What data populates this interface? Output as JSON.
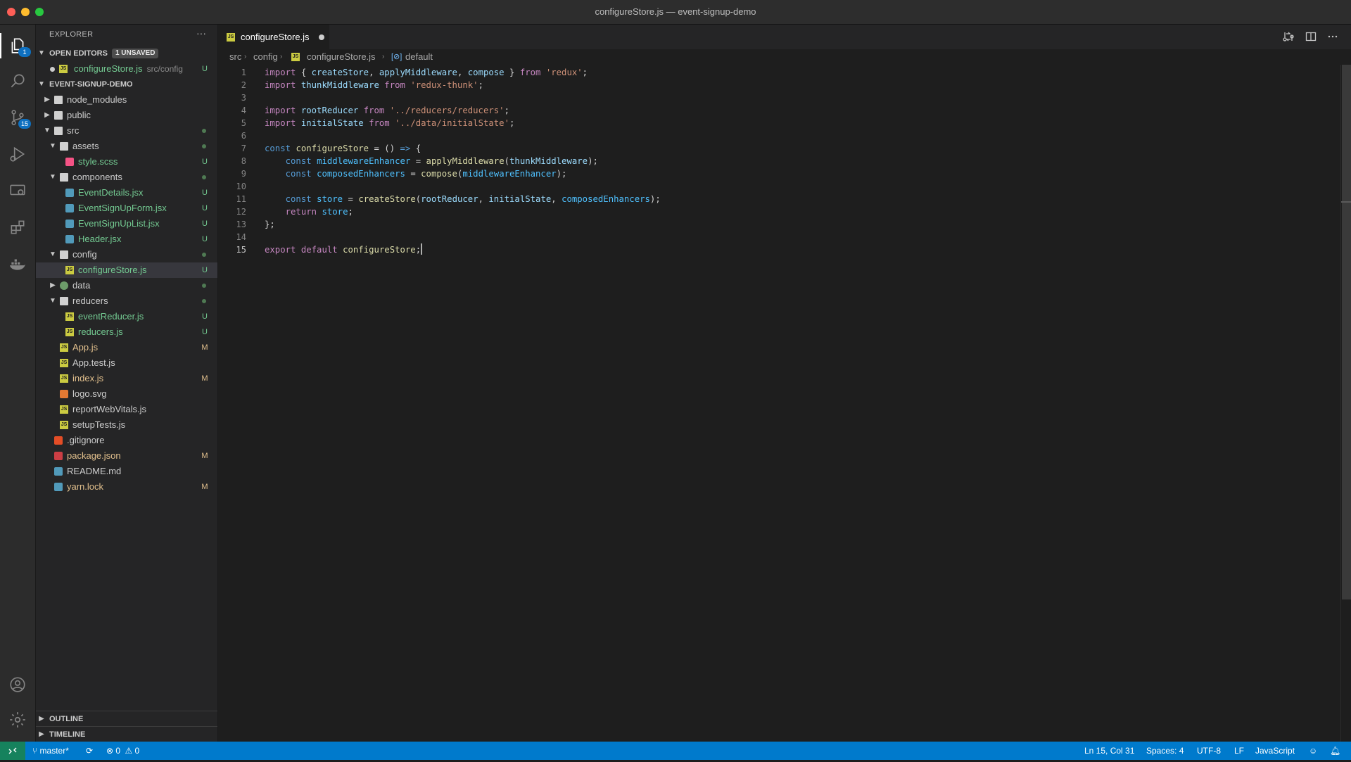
{
  "window": {
    "title": "configureStore.js — event-signup-demo"
  },
  "activity_bar": {
    "source_control_badge": "15",
    "explorer_badge": "1"
  },
  "sidebar": {
    "title": "EXPLORER",
    "more": "···",
    "open_editors": {
      "label": "OPEN EDITORS",
      "badge": "1 UNSAVED",
      "items": [
        {
          "name": "configureStore.js",
          "path": "src/config",
          "status": "U"
        }
      ]
    },
    "project": {
      "label": "EVENT-SIGNUP-DEMO",
      "tree": [
        {
          "name": "node_modules",
          "depth": 0,
          "kind": "folder",
          "open": false,
          "status": ""
        },
        {
          "name": "public",
          "depth": 0,
          "kind": "folder",
          "open": false,
          "status": ""
        },
        {
          "name": "src",
          "depth": 0,
          "kind": "folder",
          "open": true,
          "status": "dot"
        },
        {
          "name": "assets",
          "depth": 1,
          "kind": "folder",
          "open": true,
          "status": "dot"
        },
        {
          "name": "style.scss",
          "depth": 2,
          "kind": "scss",
          "status": "U"
        },
        {
          "name": "components",
          "depth": 1,
          "kind": "folder",
          "open": true,
          "status": "dot"
        },
        {
          "name": "EventDetails.jsx",
          "depth": 2,
          "kind": "jsx",
          "status": "U"
        },
        {
          "name": "EventSignUpForm.jsx",
          "depth": 2,
          "kind": "jsx",
          "status": "U"
        },
        {
          "name": "EventSignUpList.jsx",
          "depth": 2,
          "kind": "jsx",
          "status": "U"
        },
        {
          "name": "Header.jsx",
          "depth": 2,
          "kind": "jsx",
          "status": "U"
        },
        {
          "name": "config",
          "depth": 1,
          "kind": "folder",
          "open": true,
          "status": "dot"
        },
        {
          "name": "configureStore.js",
          "depth": 2,
          "kind": "js",
          "status": "U",
          "selected": true
        },
        {
          "name": "data",
          "depth": 1,
          "kind": "folder-data",
          "open": false,
          "status": "dot"
        },
        {
          "name": "reducers",
          "depth": 1,
          "kind": "folder",
          "open": true,
          "status": "dot"
        },
        {
          "name": "eventReducer.js",
          "depth": 2,
          "kind": "js",
          "status": "U"
        },
        {
          "name": "reducers.js",
          "depth": 2,
          "kind": "js",
          "status": "U"
        },
        {
          "name": "App.js",
          "depth": 1,
          "kind": "js",
          "status": "M"
        },
        {
          "name": "App.test.js",
          "depth": 1,
          "kind": "test",
          "status": ""
        },
        {
          "name": "index.js",
          "depth": 1,
          "kind": "js",
          "status": "M"
        },
        {
          "name": "logo.svg",
          "depth": 1,
          "kind": "svg",
          "status": ""
        },
        {
          "name": "reportWebVitals.js",
          "depth": 1,
          "kind": "js",
          "status": ""
        },
        {
          "name": "setupTests.js",
          "depth": 1,
          "kind": "js",
          "status": ""
        },
        {
          "name": ".gitignore",
          "depth": 0,
          "kind": "git",
          "status": ""
        },
        {
          "name": "package.json",
          "depth": 0,
          "kind": "json",
          "status": "M"
        },
        {
          "name": "README.md",
          "depth": 0,
          "kind": "md",
          "status": ""
        },
        {
          "name": "yarn.lock",
          "depth": 0,
          "kind": "yarn",
          "status": "M"
        }
      ]
    },
    "outline_label": "OUTLINE",
    "timeline_label": "TIMELINE"
  },
  "editor": {
    "tab": {
      "label": "configureStore.js",
      "dirty": true
    },
    "breadcrumb": [
      "src",
      "config",
      "configureStore.js",
      "default"
    ],
    "lines": [
      [
        [
          "kw",
          "import"
        ],
        [
          "p",
          " { "
        ],
        [
          "vr",
          "createStore"
        ],
        [
          "p",
          ", "
        ],
        [
          "vr",
          "applyMiddleware"
        ],
        [
          "p",
          ", "
        ],
        [
          "vr",
          "compose"
        ],
        [
          "p",
          " } "
        ],
        [
          "kw",
          "from"
        ],
        [
          "p",
          " "
        ],
        [
          "str",
          "'redux'"
        ],
        [
          "p",
          ";"
        ]
      ],
      [
        [
          "kw",
          "import"
        ],
        [
          "p",
          " "
        ],
        [
          "vr",
          "thunkMiddleware"
        ],
        [
          "p",
          " "
        ],
        [
          "kw",
          "from"
        ],
        [
          "p",
          " "
        ],
        [
          "str",
          "'redux-thunk'"
        ],
        [
          "p",
          ";"
        ]
      ],
      [],
      [
        [
          "kw",
          "import"
        ],
        [
          "p",
          " "
        ],
        [
          "vr",
          "rootReducer"
        ],
        [
          "p",
          " "
        ],
        [
          "kw",
          "from"
        ],
        [
          "p",
          " "
        ],
        [
          "str",
          "'../reducers/reducers'"
        ],
        [
          "p",
          ";"
        ]
      ],
      [
        [
          "kw",
          "import"
        ],
        [
          "p",
          " "
        ],
        [
          "vr",
          "initialState"
        ],
        [
          "p",
          " "
        ],
        [
          "kw",
          "from"
        ],
        [
          "p",
          " "
        ],
        [
          "str",
          "'../data/initialState'"
        ],
        [
          "p",
          ";"
        ]
      ],
      [],
      [
        [
          "kd",
          "const"
        ],
        [
          "p",
          " "
        ],
        [
          "fn",
          "configureStore"
        ],
        [
          "p",
          " = () "
        ],
        [
          "kd",
          "=>"
        ],
        [
          "p",
          " {"
        ]
      ],
      [
        [
          "p",
          "    "
        ],
        [
          "kd",
          "const"
        ],
        [
          "p",
          " "
        ],
        [
          "cn",
          "middlewareEnhancer"
        ],
        [
          "p",
          " = "
        ],
        [
          "fn",
          "applyMiddleware"
        ],
        [
          "p",
          "("
        ],
        [
          "vr",
          "thunkMiddleware"
        ],
        [
          "p",
          ");"
        ]
      ],
      [
        [
          "p",
          "    "
        ],
        [
          "kd",
          "const"
        ],
        [
          "p",
          " "
        ],
        [
          "cn",
          "composedEnhancers"
        ],
        [
          "p",
          " = "
        ],
        [
          "fn",
          "compose"
        ],
        [
          "p",
          "("
        ],
        [
          "cn",
          "middlewareEnhancer"
        ],
        [
          "p",
          ");"
        ]
      ],
      [],
      [
        [
          "p",
          "    "
        ],
        [
          "kd",
          "const"
        ],
        [
          "p",
          " "
        ],
        [
          "cn",
          "store"
        ],
        [
          "p",
          " = "
        ],
        [
          "fn",
          "createStore"
        ],
        [
          "p",
          "("
        ],
        [
          "vr",
          "rootReducer"
        ],
        [
          "p",
          ", "
        ],
        [
          "vr",
          "initialState"
        ],
        [
          "p",
          ", "
        ],
        [
          "cn",
          "composedEnhancers"
        ],
        [
          "p",
          ");"
        ]
      ],
      [
        [
          "p",
          "    "
        ],
        [
          "kw",
          "return"
        ],
        [
          "p",
          " "
        ],
        [
          "cn",
          "store"
        ],
        [
          "p",
          ";"
        ]
      ],
      [
        [
          "p",
          "};"
        ]
      ],
      [],
      [
        [
          "kw",
          "export"
        ],
        [
          "p",
          " "
        ],
        [
          "kw",
          "default"
        ],
        [
          "p",
          " "
        ],
        [
          "fn",
          "configureStore"
        ],
        [
          "p",
          ";"
        ]
      ]
    ],
    "current_line": 15
  },
  "status_bar": {
    "branch": "master*",
    "errors": "0",
    "warnings": "0",
    "cursor": "Ln 15, Col 31",
    "spaces": "Spaces: 4",
    "encoding": "UTF-8",
    "eol": "LF",
    "language": "JavaScript"
  },
  "colors": {
    "accent": "#007acc",
    "remote": "#16825d",
    "untracked": "#73c991",
    "modified": "#e2c08d"
  }
}
